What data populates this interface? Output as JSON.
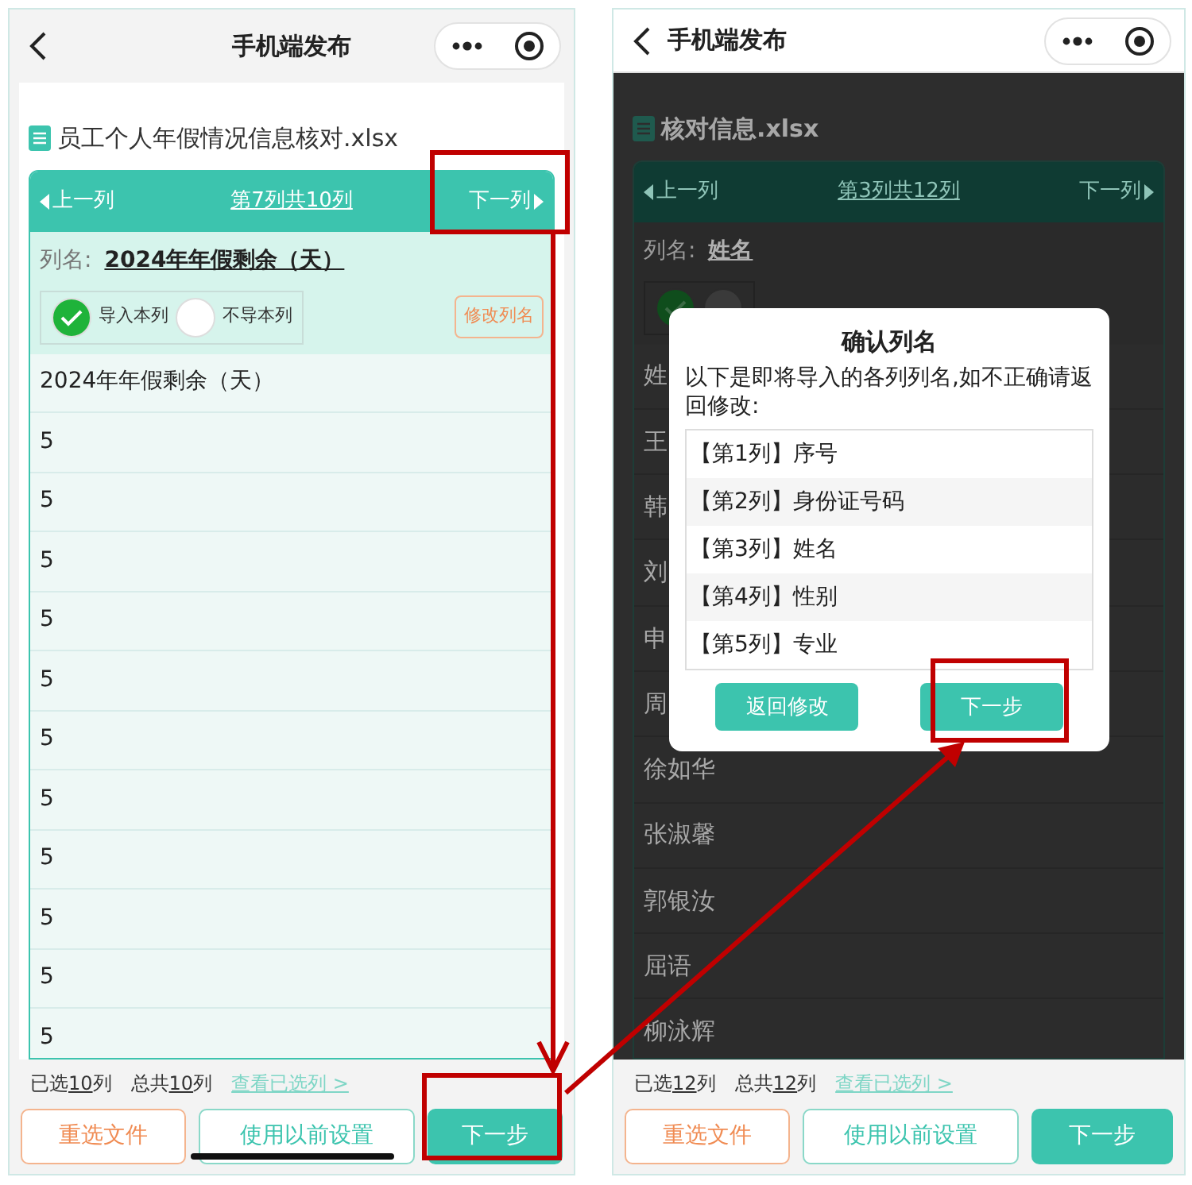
{
  "screens": [
    {
      "kind": "column-view",
      "nav_title": "手机端发布",
      "file_name": "员工个人年假情况信息核对.xlsx",
      "prev_label": "上一列",
      "position": "第7列共10列",
      "next_label": "下一列",
      "column_name_label": "列名:",
      "column_name": "2024年年假剩余（天）",
      "options": [
        {
          "label": "导入本列",
          "selected": true
        },
        {
          "label": "不导本列",
          "selected": false
        }
      ],
      "rename_button": "修改列名",
      "rows": [
        "2024年年假剩余（天）",
        "5",
        "5",
        "5",
        "5",
        "5",
        "5",
        "5",
        "5",
        "5",
        "5",
        "5"
      ],
      "summary": {
        "selected": [
          "已选",
          "10",
          "列"
        ],
        "total": [
          "总共",
          "10",
          "列"
        ],
        "view_link": "查看已选列 >"
      },
      "buttons": [
        "重选文件",
        "使用以前设置",
        "下一步"
      ]
    },
    {
      "kind": "dialog-view",
      "nav_title": "手机端发布",
      "file_name": "核对信息.xlsx",
      "prev_label": "上一列",
      "position": "第3列共12列",
      "next_label": "下一列",
      "column_name_label": "列名:",
      "column_name": "姓名",
      "options": [
        {
          "selected": true
        },
        {
          "selected": false
        }
      ],
      "rows": [
        "姓",
        "王",
        "韩",
        "刘",
        "申",
        "周",
        "徐如华",
        "张淑馨",
        "郭银汝",
        "屈语",
        "柳泳辉"
      ],
      "summary": {
        "selected": [
          "已选",
          "12",
          "列"
        ],
        "total": [
          "总共",
          "12",
          "列"
        ],
        "view_link": "查看已选列 >"
      },
      "buttons": [
        "重选文件",
        "使用以前设置",
        "下一步"
      ],
      "dialog": {
        "title": "确认列名",
        "message": "以下是即将导入的各列列名,如不正确请返回修改:",
        "items": [
          "【第1列】序号",
          "【第2列】身份证号码",
          "【第3列】姓名",
          "【第4列】性别",
          "【第5列】专业"
        ],
        "buttons": [
          "返回修改",
          "下一步"
        ]
      }
    }
  ]
}
